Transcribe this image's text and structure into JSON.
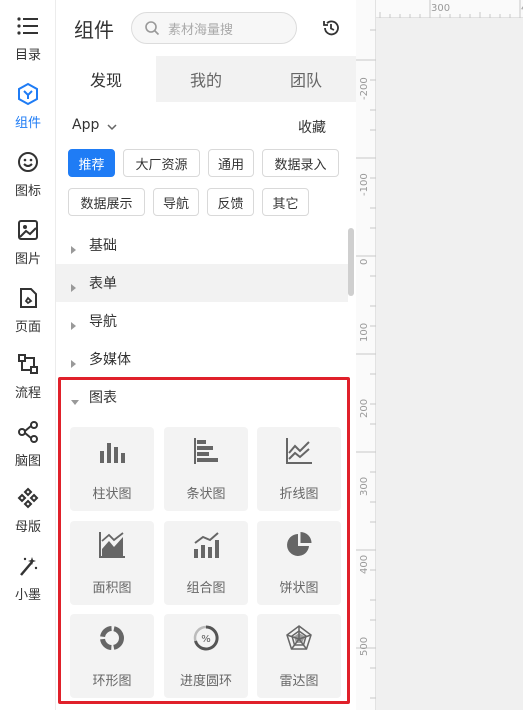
{
  "rail": {
    "items": [
      {
        "label": "目录",
        "icon": "list-icon"
      },
      {
        "label": "组件",
        "icon": "component-icon",
        "active": true
      },
      {
        "label": "图标",
        "icon": "smiley-icon"
      },
      {
        "label": "图片",
        "icon": "image-icon"
      },
      {
        "label": "页面",
        "icon": "page-icon"
      },
      {
        "label": "流程",
        "icon": "flow-icon"
      },
      {
        "label": "脑图",
        "icon": "mindmap-icon"
      },
      {
        "label": "母版",
        "icon": "master-icon"
      },
      {
        "label": "小墨",
        "icon": "magic-wand-icon"
      }
    ]
  },
  "panel": {
    "title": "组件",
    "search_placeholder": "素材海量搜",
    "tabs": [
      "发现",
      "我的",
      "团队"
    ],
    "active_tab": "发现",
    "app_selector": "App",
    "collect": "收藏",
    "chips": [
      "推荐",
      "大厂资源",
      "通用",
      "数据录入",
      "数据展示",
      "导航",
      "反馈",
      "其它"
    ],
    "tree": [
      "基础",
      "表单",
      "导航",
      "多媒体",
      "图表"
    ],
    "chart_cards": [
      "柱状图",
      "条状图",
      "折线图",
      "面积图",
      "组合图",
      "饼状图",
      "环形图",
      "进度圆环",
      "雷达图"
    ]
  },
  "ruler": {
    "h_labels": [
      "300",
      "40"
    ],
    "v_labels": [
      "-200",
      "-100",
      "0",
      "100",
      "200",
      "300",
      "400",
      "500"
    ]
  },
  "colors": {
    "accent": "#1f7cf5",
    "highlight": "#e0202a"
  }
}
